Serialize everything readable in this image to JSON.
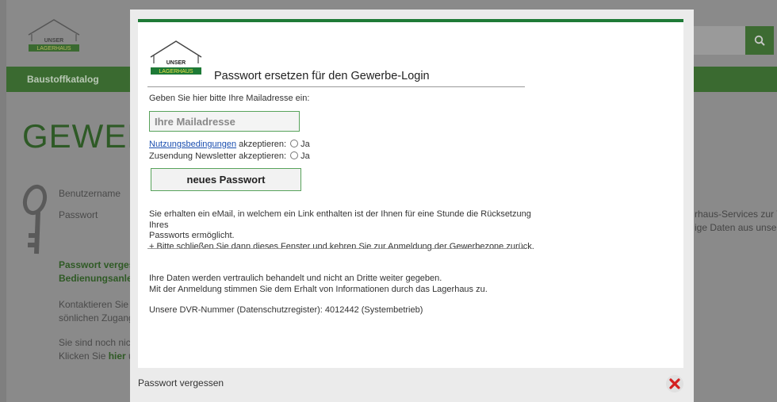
{
  "background": {
    "logo": {
      "line1": "UNSER",
      "line2": "LAGERHAUS"
    },
    "search_icon": "search-icon",
    "nav_item": "Baustoffkatalog",
    "page_title": "GEWER",
    "labels": {
      "username": "Benutzername",
      "password": "Passwort"
    },
    "links": {
      "forgot": "Passwort vergessen /",
      "manual": "Bedienungsanleitung"
    },
    "contact_lines": [
      "Kontaktieren Sie Ihre",
      "sönlichen Zugangsco"
    ],
    "signup": {
      "line1": "Sie sind noch nicht (",
      "line2_pre": "Klicken Sie ",
      "line2_link": "hier",
      "line2_post": " und"
    },
    "right_text": [
      "rhaus-Services zur Verfü",
      "ige Daten aus unserem"
    ]
  },
  "modal": {
    "logo": {
      "line1": "UNSER",
      "line2": "LAGERHAUS"
    },
    "heading": "Passwort ersetzen für den Gewerbe-Login",
    "prompt": "Geben Sie hier bitte Ihre Mailadresse ein:",
    "email": {
      "value": "",
      "placeholder": "Ihre Mailadresse"
    },
    "terms": {
      "link": "Nutzungsbedingungen",
      "text": " akzeptieren:",
      "option": "Ja"
    },
    "newsletter": {
      "text": "Zusendung Newsletter akzeptieren:",
      "option": "Ja"
    },
    "submit_label": "neues Passwort",
    "info_line1": "Sie erhalten ein eMail, in welchem ein Link enthalten ist der Ihnen für eine Stunde die Rücksetzung Ihres",
    "info_line2": "Passworts ermöglicht.",
    "info_line3": "+ Bitte schließen Sie dann dieses Fenster und kehren Sie zur Anmeldung der Gewerbezone zurück.",
    "privacy_line1": "Ihre Daten werden vertraulich behandelt und nicht an Dritte weiter gegeben.",
    "privacy_line2": "Mit der Anmeldung stimmen Sie dem Erhalt von Informationen durch das Lagerhaus zu.",
    "dvr": "Unsere DVR-Nummer (Datenschutzregister): 4012442 (Systembetrieb)",
    "footer_title": "Passwort vergessen",
    "close_icon": "close-icon"
  },
  "colors": {
    "brand_green": "#1e7a36",
    "close_red": "#d42020",
    "link_blue": "#1b4fb0"
  }
}
